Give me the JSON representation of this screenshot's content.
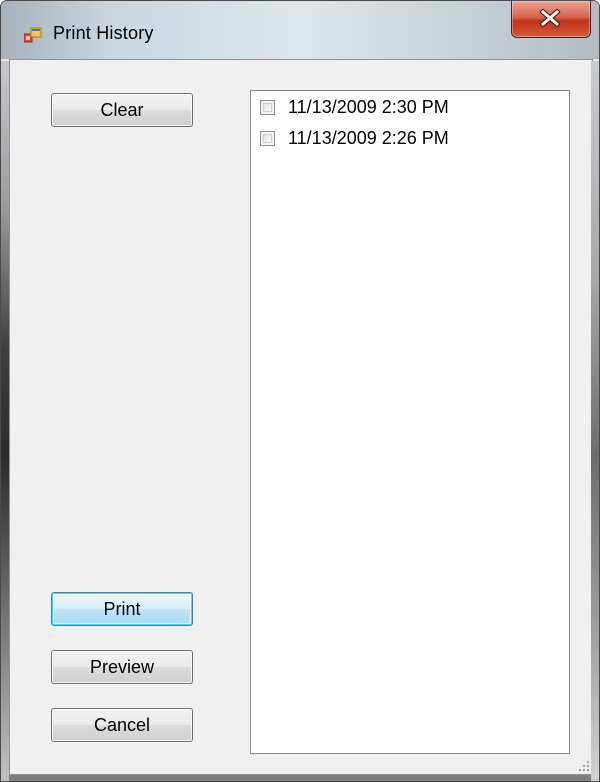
{
  "window": {
    "title": "Print History",
    "icon": "app-window-icon",
    "close_icon": "close-icon"
  },
  "buttons": {
    "clear": "Clear",
    "print": "Print",
    "preview": "Preview",
    "cancel": "Cancel"
  },
  "history_list": {
    "items": [
      {
        "label": "11/13/2009 2:30 PM",
        "checked": false
      },
      {
        "label": "11/13/2009 2:26 PM",
        "checked": false
      }
    ]
  },
  "colors": {
    "close_button": "#c7422a",
    "default_button_border": "#3c7fb1",
    "client_background": "#f0f0f0"
  }
}
